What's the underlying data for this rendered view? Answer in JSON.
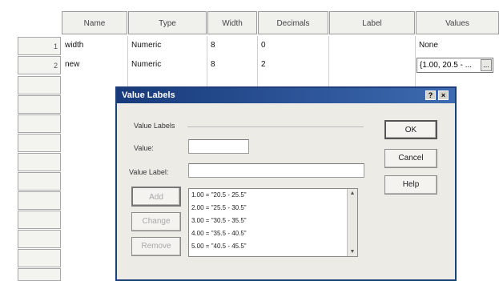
{
  "grid": {
    "columns": [
      "Name",
      "Type",
      "Width",
      "Decimals",
      "Label",
      "Values"
    ],
    "rows": [
      {
        "num": "1",
        "name": "width",
        "type": "Numeric",
        "width": "8",
        "decimals": "0",
        "label": "",
        "values": "None"
      },
      {
        "num": "2",
        "name": "new",
        "type": "Numeric",
        "width": "8",
        "decimals": "2",
        "label": "",
        "values": "{1.00, 20.5 - ..."
      }
    ],
    "values_button": "..."
  },
  "dialog": {
    "title": "Value Labels",
    "group_label": "Value Labels",
    "value_label": "Value:",
    "label_label": "Value Label:",
    "value_input": "",
    "label_input": "",
    "buttons": {
      "ok": "OK",
      "cancel": "Cancel",
      "help": "Help",
      "add": "Add",
      "change": "Change",
      "remove": "Remove"
    },
    "list_items": [
      "1.00 = \"20.5 - 25.5\"",
      "2.00 = \"25.5 - 30.5\"",
      "3.00 = \"30.5 - 35.5\"",
      "4.00 = \"35.5 - 40.5\"",
      "5.00 = \"40.5 - 45.5\""
    ],
    "titlebar_buttons": {
      "help": "?",
      "close": "×"
    }
  },
  "colors": {
    "title_bar": "#183a7a",
    "dialog_bg": "#ecebe6",
    "grid_header": "#f0f0ec"
  }
}
